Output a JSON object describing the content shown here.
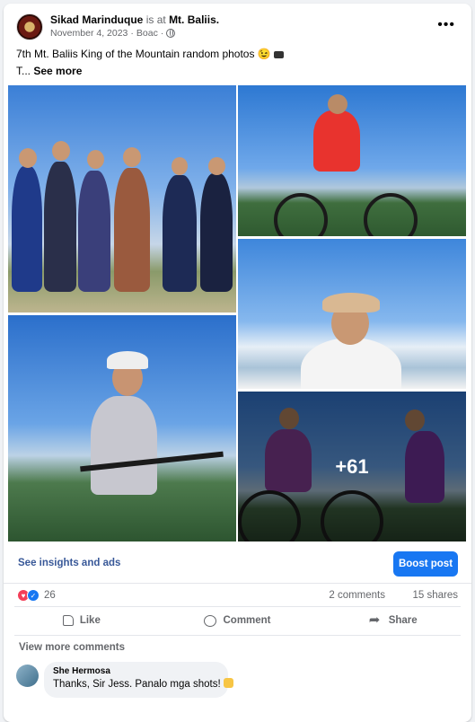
{
  "post": {
    "author": "Sikad Marinduque",
    "is_at_text": "is at",
    "location": "Mt. Baliis.",
    "date": "November 4, 2023",
    "separator": "·",
    "place": "Boac",
    "caption_line1": "7th Mt. Baliis King of the Mountain random photos 😉",
    "caption_line2_start": "T...",
    "see_more": "See more",
    "more_photos_overlay": "+61"
  },
  "actions": {
    "insights_link": "See insights and ads",
    "boost_button": "Boost post"
  },
  "stats": {
    "reaction_count": "26",
    "comments": "2 comments",
    "shares": "15 shares"
  },
  "buttons": {
    "like": "Like",
    "comment": "Comment",
    "share": "Share"
  },
  "comments": {
    "view_more": "View more comments",
    "items": [
      {
        "author": "She Hermosa",
        "text": "Thanks, Sir Jess. Panalo mga shots!"
      }
    ]
  },
  "icons": [
    "page-avatar",
    "globe-icon",
    "more-options-icon",
    "camera-emoji",
    "love-reaction-icon",
    "like-reaction-icon",
    "like-icon",
    "comment-icon",
    "share-icon",
    "flex-emoji"
  ],
  "colors": {
    "accent": "#1877f2",
    "link": "#385898",
    "love": "#f33e58",
    "muted_text": "#65676b",
    "background": "#f0f2f5"
  }
}
